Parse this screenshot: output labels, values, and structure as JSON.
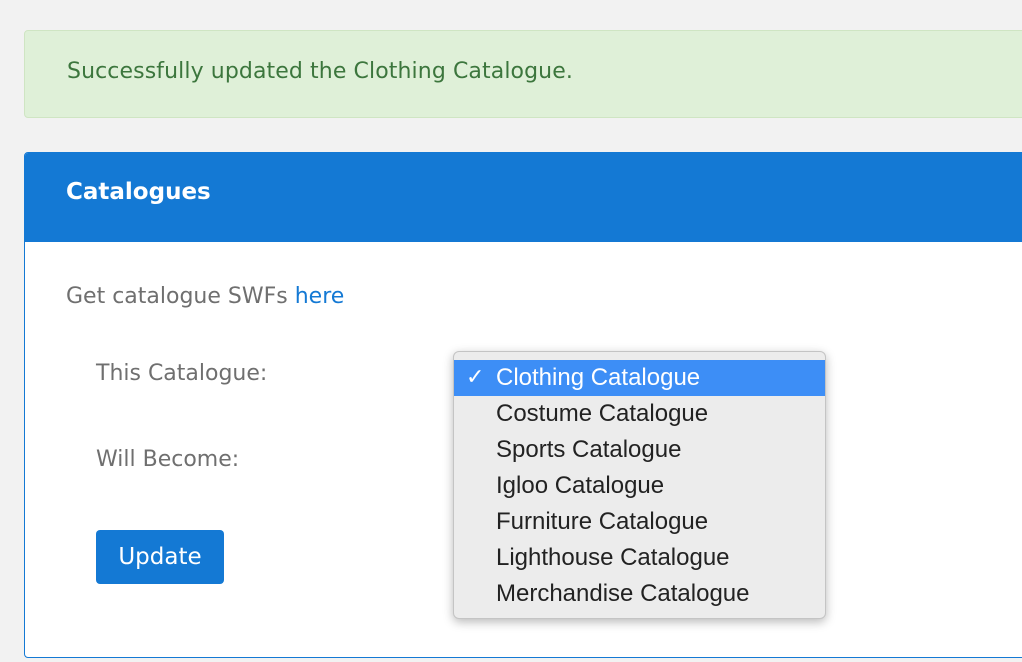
{
  "alert": {
    "message": "Successfully updated the Clothing Catalogue."
  },
  "panel": {
    "title": "Catalogues",
    "intro_text": "Get catalogue SWFs ",
    "intro_link": "here",
    "this_label": "This Catalogue:",
    "become_label": "Will Become:",
    "update_label": "Update"
  },
  "dropdown": {
    "check_glyph": "✓",
    "selected_index": 0,
    "options": [
      "Clothing Catalogue",
      "Costume Catalogue",
      "Sports Catalogue",
      "Igloo Catalogue",
      "Furniture Catalogue",
      "Lighthouse Catalogue",
      "Merchandise Catalogue"
    ]
  },
  "colors": {
    "accent": "#1479d4",
    "success_bg": "#dff0d8",
    "success_text": "#3c763d",
    "dropdown_highlight": "#3d8ef6"
  }
}
